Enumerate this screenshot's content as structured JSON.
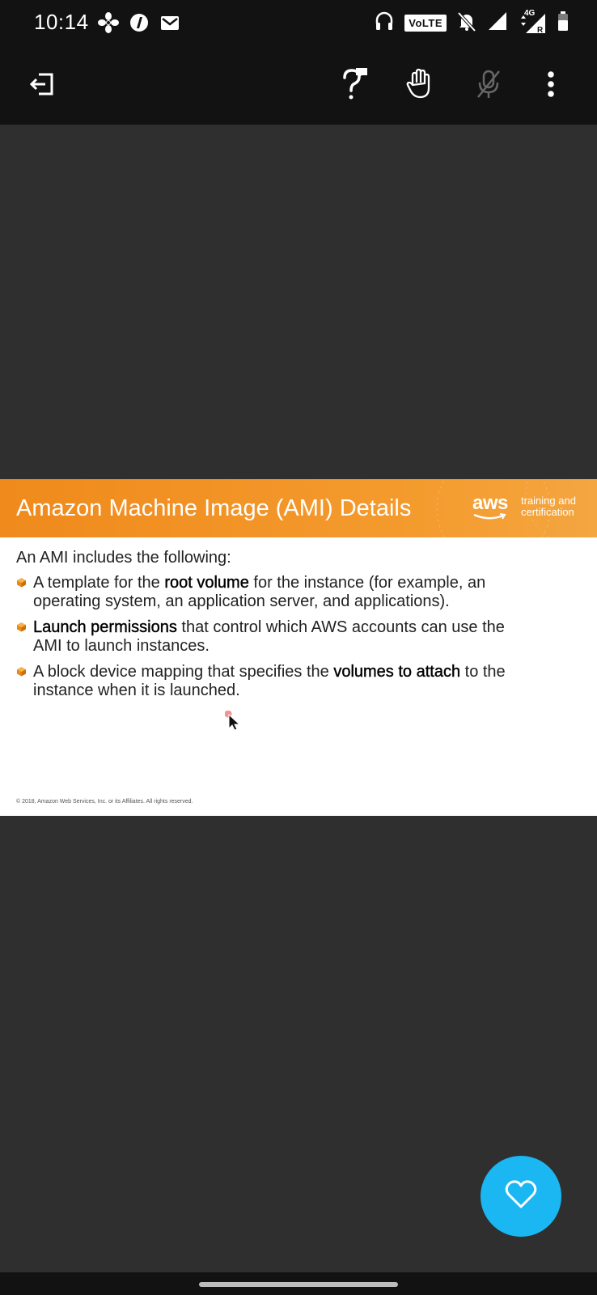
{
  "status_bar": {
    "time": "10:14",
    "network_badge": "VoLTE",
    "network_type": "4G",
    "roaming": "R",
    "icons": [
      "fan-icon",
      "edge-icon",
      "gmail-icon",
      "headset-icon",
      "notifications-off-icon",
      "signal-icon",
      "signal-roaming-icon",
      "battery-icon"
    ]
  },
  "toolbar": {
    "icons": [
      "exit-icon",
      "question-icon",
      "raise-hand-icon",
      "mic-off-icon",
      "more-vert-icon"
    ]
  },
  "slide": {
    "title": "Amazon Machine Image (AMI) Details",
    "logo_text": "aws",
    "tagline_line1": "training and",
    "tagline_line2": "certification",
    "intro": "An AMI includes the following:",
    "bullets": [
      {
        "pre": "A template for the ",
        "bold": "root volume",
        "post": " for the instance (for example, an operating system, an application server, and applications)."
      },
      {
        "pre": "",
        "bold": "Launch permissions",
        "post": " that control which AWS accounts can use the AMI to launch instances."
      },
      {
        "pre": "A block device mapping that specifies the ",
        "bold": "volumes to attach",
        "post": " to the instance when it is launched."
      }
    ],
    "footer": "© 2018, Amazon Web Services, Inc. or its Affiliates. All rights reserved.",
    "accent_color": "#f4951f"
  },
  "fab": {
    "icon": "heart-icon",
    "color": "#1ab7f2"
  }
}
